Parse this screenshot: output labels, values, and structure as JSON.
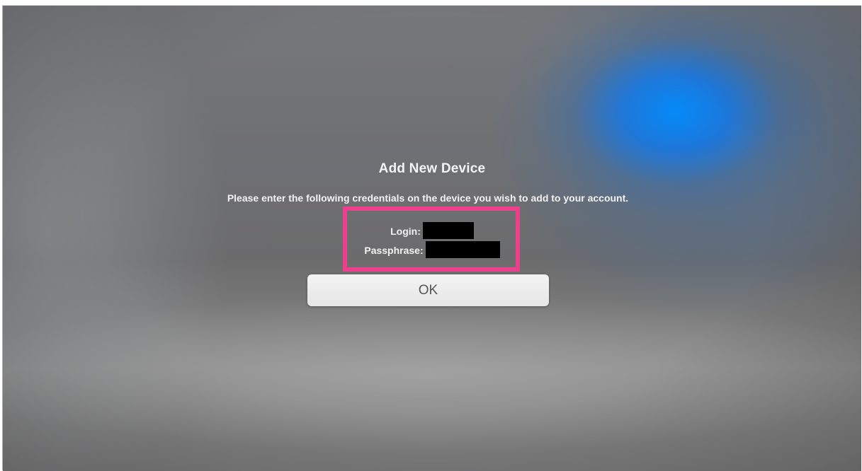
{
  "dialog": {
    "title": "Add New Device",
    "message": "Please enter the following credentials on the device you wish to add to your account.",
    "login_label": "Login:",
    "passphrase_label": "Passphrase:",
    "ok_label": "OK"
  },
  "annotation": {
    "highlight_color": "#ee3f8c"
  },
  "colors": {
    "background": "#6f7073",
    "glow": "#0a8cff",
    "text": "#f4f4f4",
    "button": "#eeeeee",
    "button_text": "#555555",
    "redaction": "#000000"
  }
}
